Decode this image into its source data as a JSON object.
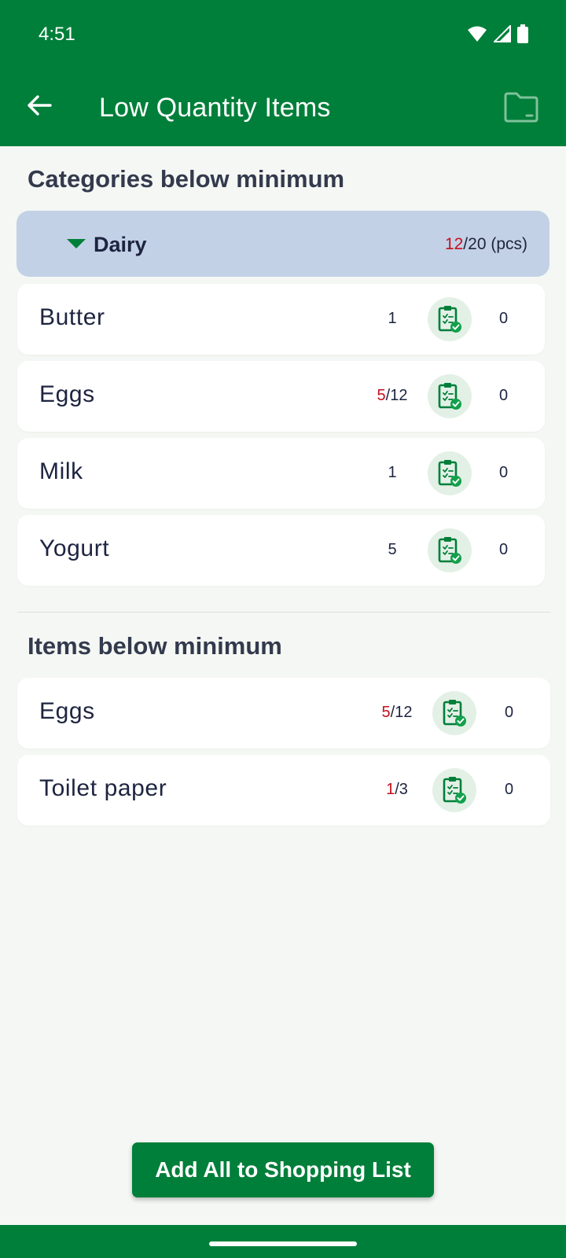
{
  "status_bar": {
    "time": "4:51",
    "icons": [
      "wifi-icon",
      "signal-icon",
      "battery-icon"
    ]
  },
  "app_bar": {
    "title": "Low Quantity Items",
    "back_icon": "arrow-left-icon",
    "action_icon": "folder-icon"
  },
  "sections": {
    "categories_title": "Categories below minimum",
    "items_title": "Items below minimum"
  },
  "category": {
    "name": "Dairy",
    "current": "12",
    "separator": "/",
    "total": "20 (pcs)"
  },
  "category_items": [
    {
      "name": "Butter",
      "current": "1",
      "min": "",
      "extra": "0"
    },
    {
      "name": "Eggs",
      "current": "5",
      "min": "/12",
      "extra": "0"
    },
    {
      "name": "Milk",
      "current": "1",
      "min": "",
      "extra": "0"
    },
    {
      "name": "Yogurt",
      "current": "5",
      "min": "",
      "extra": "0"
    }
  ],
  "low_items": [
    {
      "name": "Eggs",
      "current": "5",
      "min": "/12",
      "extra": "0"
    },
    {
      "name": "Toilet paper",
      "current": "1",
      "min": "/3",
      "extra": "0"
    }
  ],
  "footer": {
    "add_all_label": "Add All to Shopping List"
  },
  "colors": {
    "primary": "#007f3a",
    "category_header": "#c3d1e6",
    "low_value": "#c3101e",
    "background": "#f4f7f3"
  }
}
